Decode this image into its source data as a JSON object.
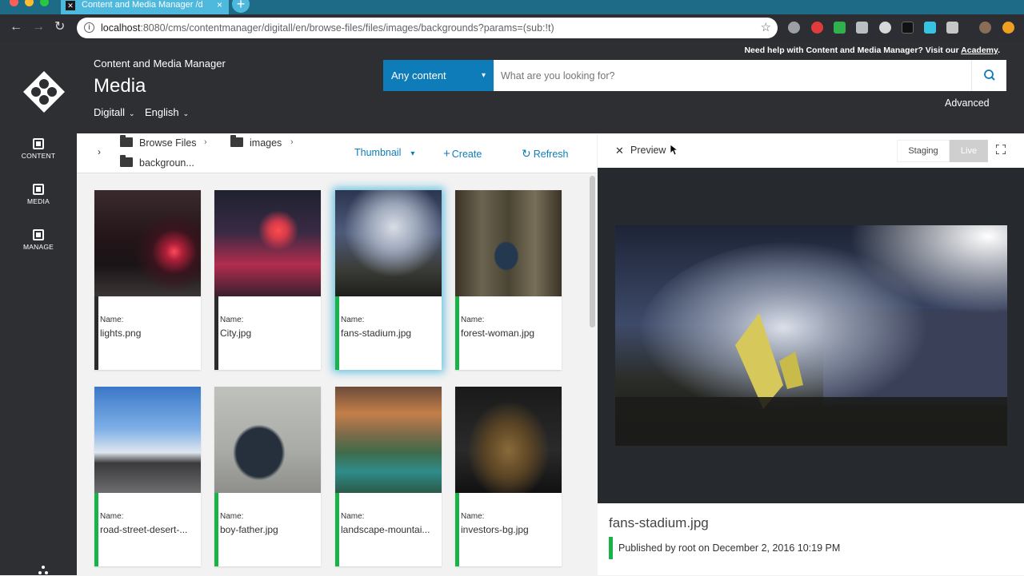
{
  "browser": {
    "tab_title": "Content and Media Manager /d",
    "url_host": "localhost",
    "url_path": ":8080/cms/contentmanager/digitall/en/browse-files/files/images/backgrounds?params=(sub:!t)"
  },
  "app": {
    "name": "Content and Media Manager",
    "page_title": "Media",
    "site": "Digitall",
    "language": "English",
    "help_prefix": "Need help with Content and Media Manager? Visit our ",
    "help_link": "Academy",
    "help_suffix": ".",
    "advanced": "Advanced"
  },
  "search": {
    "type": "Any content",
    "placeholder": "What are you looking for?"
  },
  "sidebar": {
    "items": [
      {
        "label": "CONTENT"
      },
      {
        "label": "MEDIA"
      },
      {
        "label": "MANAGE"
      }
    ]
  },
  "breadcrumb": [
    "Browse Files",
    "images",
    "backgroun..."
  ],
  "toolbar": {
    "view": "Thumbnail",
    "create": "Create",
    "refresh": "Refresh"
  },
  "files": [
    {
      "name_label": "Name:",
      "name": "lights.png",
      "status_color": "#2b2b2b"
    },
    {
      "name_label": "Name:",
      "name": "City.jpg",
      "status_color": "#2b2b2b"
    },
    {
      "name_label": "Name:",
      "name": "fans-stadium.jpg",
      "status_color": "#19b34a",
      "selected": true
    },
    {
      "name_label": "Name:",
      "name": "forest-woman.jpg",
      "status_color": "#19b34a"
    },
    {
      "name_label": "Name:",
      "name": "road-street-desert-...",
      "status_color": "#19b34a"
    },
    {
      "name_label": "Name:",
      "name": "boy-father.jpg",
      "status_color": "#19b34a"
    },
    {
      "name_label": "Name:",
      "name": "landscape-mountai...",
      "status_color": "#19b34a"
    },
    {
      "name_label": "Name:",
      "name": "investors-bg.jpg",
      "status_color": "#19b34a"
    }
  ],
  "preview": {
    "title": "Preview",
    "staging": "Staging",
    "live": "Live",
    "file_name": "fans-stadium.jpg",
    "published": "Published by root on December 2, 2016 10:19 PM"
  },
  "colors": {
    "accent": "#0f7cba",
    "published": "#19b34a",
    "unpublished": "#2b2b2b",
    "header_bg": "#2d2f33"
  }
}
